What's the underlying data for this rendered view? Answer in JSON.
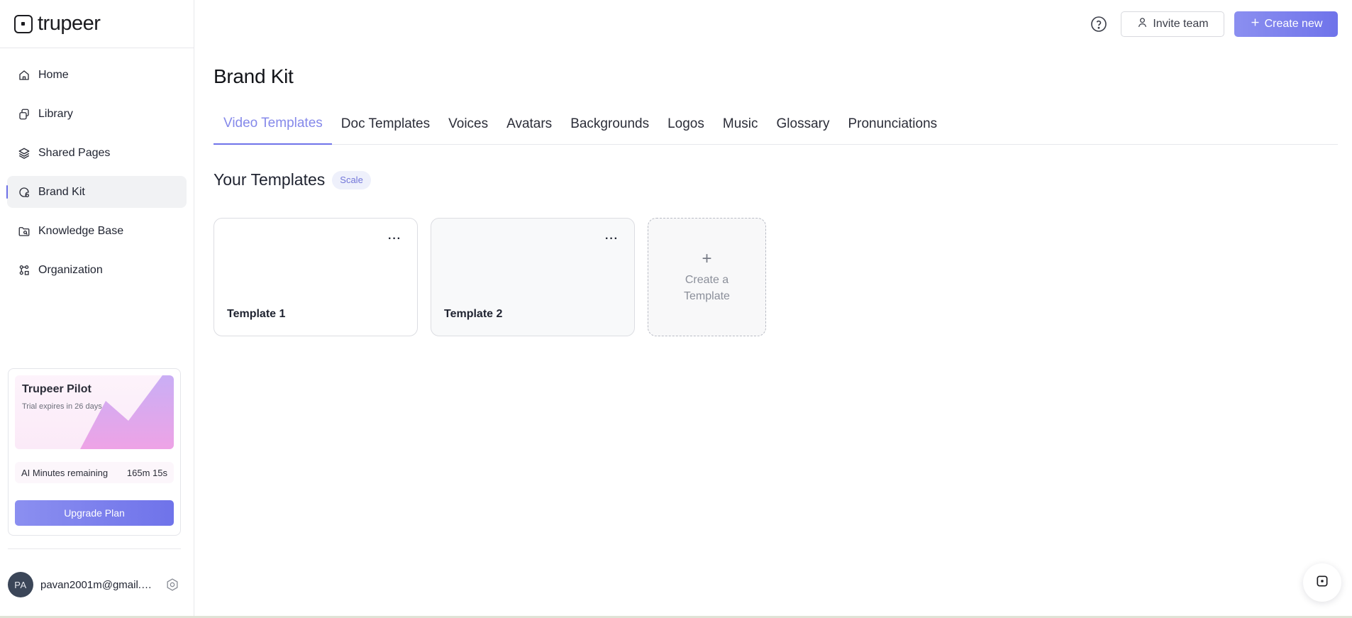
{
  "app": {
    "logo_text": "trupeer"
  },
  "sidebar": {
    "items": [
      {
        "label": "Home",
        "icon": "home-icon",
        "active": false
      },
      {
        "label": "Library",
        "icon": "library-icon",
        "active": false
      },
      {
        "label": "Shared Pages",
        "icon": "layers-icon",
        "active": false
      },
      {
        "label": "Brand Kit",
        "icon": "brand-kit-icon",
        "active": true
      },
      {
        "label": "Knowledge Base",
        "icon": "folder-search-icon",
        "active": false
      },
      {
        "label": "Organization",
        "icon": "organization-icon",
        "active": false
      }
    ],
    "plan_card": {
      "title": "Trupeer Pilot",
      "subtitle": "Trial expires in 26 days",
      "minutes_label": "AI Minutes remaining",
      "minutes_value": "165m 15s",
      "upgrade_label": "Upgrade Plan"
    },
    "user": {
      "initials": "PA",
      "email": "pavan2001m@gmail.c..."
    }
  },
  "header": {
    "invite_label": "Invite team",
    "create_label": "Create new"
  },
  "main": {
    "title": "Brand Kit",
    "tabs": [
      {
        "label": "Video Templates",
        "active": true
      },
      {
        "label": "Doc Templates",
        "active": false
      },
      {
        "label": "Voices",
        "active": false
      },
      {
        "label": "Avatars",
        "active": false
      },
      {
        "label": "Backgrounds",
        "active": false
      },
      {
        "label": "Logos",
        "active": false
      },
      {
        "label": "Music",
        "active": false
      },
      {
        "label": "Glossary",
        "active": false
      },
      {
        "label": "Pronunciations",
        "active": false
      }
    ],
    "section_title": "Your Templates",
    "section_badge": "Scale",
    "templates": [
      {
        "name": "Template 1",
        "more": "···"
      },
      {
        "name": "Template 2",
        "more": "···"
      }
    ],
    "add_template": {
      "plus": "+",
      "label": "Create a Template"
    }
  },
  "colors": {
    "accent": "#6f73ea",
    "accent_light": "#8589ea",
    "avatar_bg": "#3b4658"
  }
}
